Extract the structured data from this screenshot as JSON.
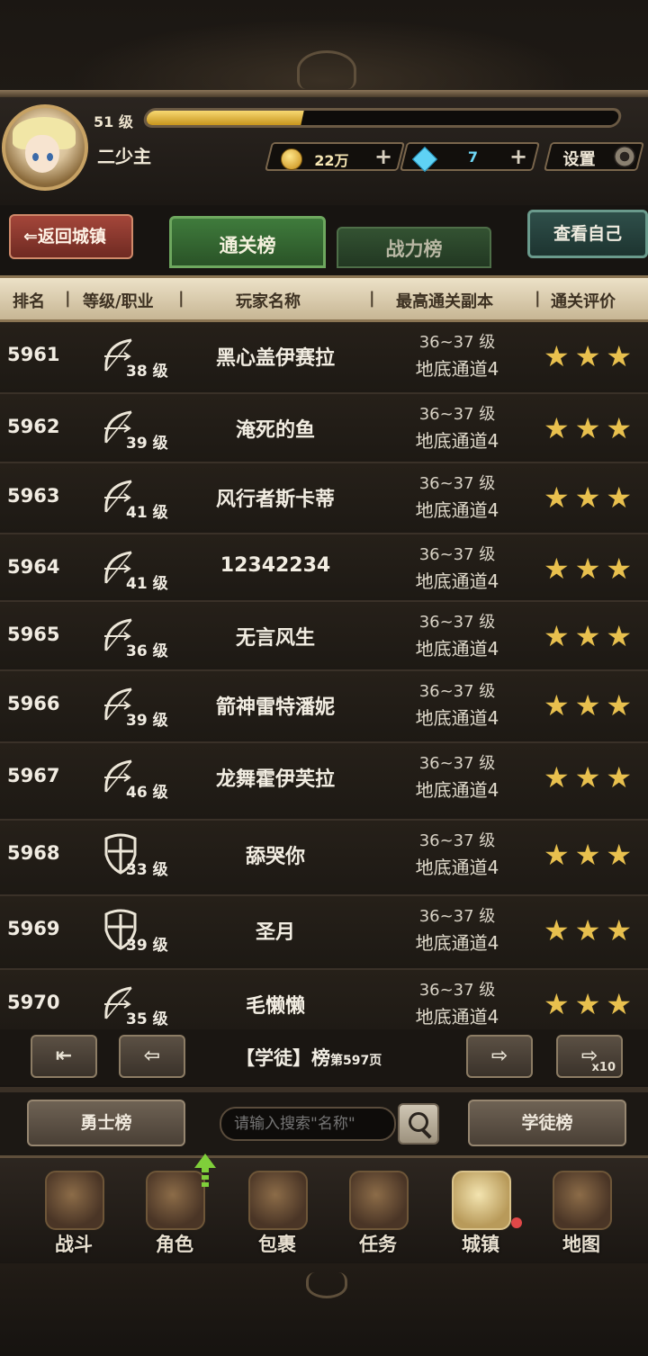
{
  "player": {
    "level_label": "51 级",
    "xp_fraction": 0.33,
    "name": "二少主",
    "gold": "22万",
    "diamonds": "7",
    "settings_label": "设置"
  },
  "nav_top": {
    "back_label": "返回城镇",
    "tab_clear": "通关榜",
    "tab_power": "战力榜",
    "view_self_label": "查看自己"
  },
  "table": {
    "headers": [
      "排名",
      "等级/职业",
      "玩家名称",
      "最高通关副本",
      "通关评价"
    ],
    "rows": [
      {
        "rank": "5961",
        "class": "archer",
        "level": "38 级",
        "name": "黑心盖伊赛拉",
        "range": "36~37 级",
        "dungeon": "地底通道4",
        "stars": "★★★"
      },
      {
        "rank": "5962",
        "class": "archer",
        "level": "39 级",
        "name": "淹死的鱼",
        "range": "36~37 级",
        "dungeon": "地底通道4",
        "stars": "★★★"
      },
      {
        "rank": "5963",
        "class": "archer",
        "level": "41 级",
        "name": "风行者斯卡蒂",
        "range": "36~37 级",
        "dungeon": "地底通道4",
        "stars": "★★★"
      },
      {
        "rank": "5964",
        "class": "archer",
        "level": "41 级",
        "name": "12342234",
        "range": "36~37 级",
        "dungeon": "地底通道4",
        "stars": "★★★"
      },
      {
        "rank": "5965",
        "class": "archer",
        "level": "36 级",
        "name": "无言风生",
        "range": "36~37 级",
        "dungeon": "地底通道4",
        "stars": "★★★"
      },
      {
        "rank": "5966",
        "class": "archer",
        "level": "39 级",
        "name": "箭神雷特潘妮",
        "range": "36~37 级",
        "dungeon": "地底通道4",
        "stars": "★★★"
      },
      {
        "rank": "5967",
        "class": "archer",
        "level": "46 级",
        "name": "龙舞霍伊芙拉",
        "range": "36~37 级",
        "dungeon": "地底通道4",
        "stars": "★★★"
      },
      {
        "rank": "5968",
        "class": "shield",
        "level": "33 级",
        "name": "舔哭你",
        "range": "36~37 级",
        "dungeon": "地底通道4",
        "stars": "★★★"
      },
      {
        "rank": "5969",
        "class": "shield",
        "level": "39 级",
        "name": "圣月",
        "range": "36~37 级",
        "dungeon": "地底通道4",
        "stars": "★★★"
      },
      {
        "rank": "5970",
        "class": "archer",
        "level": "35 级",
        "name": "毛懒懒",
        "range": "36~37 级",
        "dungeon": "地底通道4",
        "stars": "★★★"
      }
    ]
  },
  "pager": {
    "title": "【学徒】榜",
    "page_label": "第597页",
    "x10_label": "x10"
  },
  "search": {
    "warrior_board": "勇士榜",
    "placeholder": "请输入搜索\"名称\"",
    "apprentice_board": "学徒榜"
  },
  "bottom_nav": [
    {
      "label": "战斗",
      "icon": "battle-icon"
    },
    {
      "label": "角色",
      "icon": "character-icon"
    },
    {
      "label": "包裹",
      "icon": "bag-icon"
    },
    {
      "label": "任务",
      "icon": "quest-icon"
    },
    {
      "label": "城镇",
      "icon": "town-icon"
    },
    {
      "label": "地图",
      "icon": "map-icon"
    }
  ]
}
